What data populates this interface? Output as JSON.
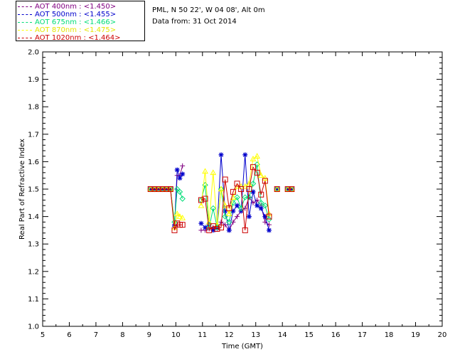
{
  "header": {
    "site_line": "PML, N 50 22', W 04 08', Alt 0m",
    "date_line": "Data from: 31 Oct 2014"
  },
  "legend": {
    "items": [
      {
        "label": "AOT  400nm : <1.450>",
        "color": "#800080"
      },
      {
        "label": "AOT  500nm : <1.455>",
        "color": "#0000cc"
      },
      {
        "label": "AOT  675nm : <1.466>",
        "color": "#00dd77"
      },
      {
        "label": "AOT  870nm : <1.475>",
        "color": "#ffff00"
      },
      {
        "label": "AOT 1020nm : <1.464>",
        "color": "#cc0000"
      }
    ]
  },
  "chart_data": {
    "type": "line",
    "xlabel": "Time (GMT)",
    "ylabel": "Real Part of Refractive Index",
    "xlim": [
      5,
      20
    ],
    "ylim": [
      1.0,
      2.0
    ],
    "x_ticks": [
      "5",
      "6",
      "7",
      "8",
      "9",
      "10",
      "11",
      "12",
      "13",
      "14",
      "15",
      "16",
      "17",
      "18",
      "19",
      "20"
    ],
    "y_ticks": [
      "1.0",
      "1.1",
      "1.2",
      "1.3",
      "1.4",
      "1.5",
      "1.6",
      "1.7",
      "1.8",
      "1.9",
      "2.0"
    ],
    "series": [
      {
        "name": "AOT  400nm : <1.450>",
        "color": "#800080",
        "marker": "plus",
        "x": [
          9.05,
          9.2,
          9.35,
          9.5,
          9.65,
          9.8,
          9.95,
          10.05,
          10.15,
          10.25,
          10.95,
          11.1,
          11.25,
          11.4,
          11.55,
          11.7,
          11.85,
          12.0,
          12.15,
          12.3,
          12.45,
          12.6,
          12.75,
          12.9,
          13.05,
          13.2,
          13.35,
          13.5,
          13.8,
          14.2,
          14.35
        ],
        "y": [
          1.5,
          1.5,
          1.5,
          1.5,
          1.5,
          1.5,
          1.37,
          1.55,
          1.55,
          1.585,
          1.35,
          1.35,
          1.355,
          1.36,
          1.355,
          1.38,
          1.37,
          1.35,
          1.38,
          1.4,
          1.42,
          1.43,
          1.47,
          1.45,
          1.46,
          1.44,
          1.38,
          1.37,
          1.5,
          1.5,
          1.5
        ]
      },
      {
        "name": "AOT  500nm : <1.455>",
        "color": "#0000cc",
        "marker": "asterisk",
        "x": [
          9.05,
          9.2,
          9.35,
          9.5,
          9.65,
          9.8,
          9.95,
          10.05,
          10.15,
          10.25,
          10.95,
          11.1,
          11.25,
          11.4,
          11.55,
          11.7,
          11.85,
          12.0,
          12.15,
          12.3,
          12.45,
          12.6,
          12.75,
          12.9,
          13.05,
          13.2,
          13.35,
          13.5,
          13.8,
          14.2,
          14.35
        ],
        "y": [
          1.5,
          1.5,
          1.5,
          1.5,
          1.5,
          1.5,
          1.365,
          1.57,
          1.54,
          1.555,
          1.375,
          1.36,
          1.37,
          1.35,
          1.36,
          1.625,
          1.42,
          1.35,
          1.42,
          1.44,
          1.42,
          1.625,
          1.4,
          1.49,
          1.44,
          1.43,
          1.4,
          1.35,
          1.5,
          1.5,
          1.5
        ]
      },
      {
        "name": "AOT  675nm : <1.466>",
        "color": "#00dd77",
        "marker": "diamond",
        "x": [
          9.05,
          9.2,
          9.35,
          9.5,
          9.65,
          9.8,
          9.95,
          10.05,
          10.15,
          10.25,
          10.95,
          11.1,
          11.25,
          11.4,
          11.55,
          11.7,
          11.85,
          12.0,
          12.15,
          12.3,
          12.45,
          12.6,
          12.75,
          12.9,
          13.05,
          13.2,
          13.35,
          13.5,
          13.8,
          14.2,
          14.35
        ],
        "y": [
          1.5,
          1.5,
          1.5,
          1.5,
          1.5,
          1.5,
          1.38,
          1.5,
          1.49,
          1.465,
          1.46,
          1.515,
          1.36,
          1.43,
          1.36,
          1.5,
          1.4,
          1.38,
          1.45,
          1.47,
          1.43,
          1.47,
          1.47,
          1.52,
          1.59,
          1.45,
          1.44,
          1.39,
          1.5,
          1.5,
          1.5
        ]
      },
      {
        "name": "AOT  870nm : <1.475>",
        "color": "#ffff00",
        "marker": "triangle",
        "x": [
          9.05,
          9.2,
          9.35,
          9.5,
          9.65,
          9.8,
          9.95,
          10.05,
          10.15,
          10.25,
          10.95,
          11.1,
          11.25,
          11.4,
          11.55,
          11.7,
          11.85,
          12.0,
          12.15,
          12.3,
          12.45,
          12.6,
          12.75,
          12.9,
          13.05,
          13.2,
          13.35,
          13.5,
          13.8,
          14.2,
          14.35
        ],
        "y": [
          1.5,
          1.5,
          1.5,
          1.5,
          1.5,
          1.5,
          1.36,
          1.41,
          1.4,
          1.395,
          1.44,
          1.565,
          1.38,
          1.56,
          1.37,
          1.5,
          1.44,
          1.41,
          1.47,
          1.51,
          1.51,
          1.51,
          1.52,
          1.61,
          1.62,
          1.55,
          1.54,
          1.41,
          1.5,
          1.5,
          1.5
        ]
      },
      {
        "name": "AOT 1020nm : <1.464>",
        "color": "#cc0000",
        "marker": "square",
        "x": [
          9.05,
          9.2,
          9.35,
          9.5,
          9.65,
          9.8,
          9.95,
          10.05,
          10.15,
          10.25,
          10.95,
          11.1,
          11.25,
          11.4,
          11.55,
          11.7,
          11.85,
          12.0,
          12.15,
          12.3,
          12.45,
          12.6,
          12.75,
          12.9,
          13.05,
          13.2,
          13.35,
          13.5,
          13.8,
          14.2,
          14.35
        ],
        "y": [
          1.5,
          1.5,
          1.5,
          1.5,
          1.5,
          1.5,
          1.35,
          1.375,
          1.37,
          1.37,
          1.46,
          1.465,
          1.35,
          1.365,
          1.355,
          1.36,
          1.535,
          1.43,
          1.49,
          1.52,
          1.5,
          1.35,
          1.5,
          1.58,
          1.56,
          1.48,
          1.53,
          1.4,
          1.5,
          1.5,
          1.5
        ]
      }
    ],
    "grid": false
  }
}
